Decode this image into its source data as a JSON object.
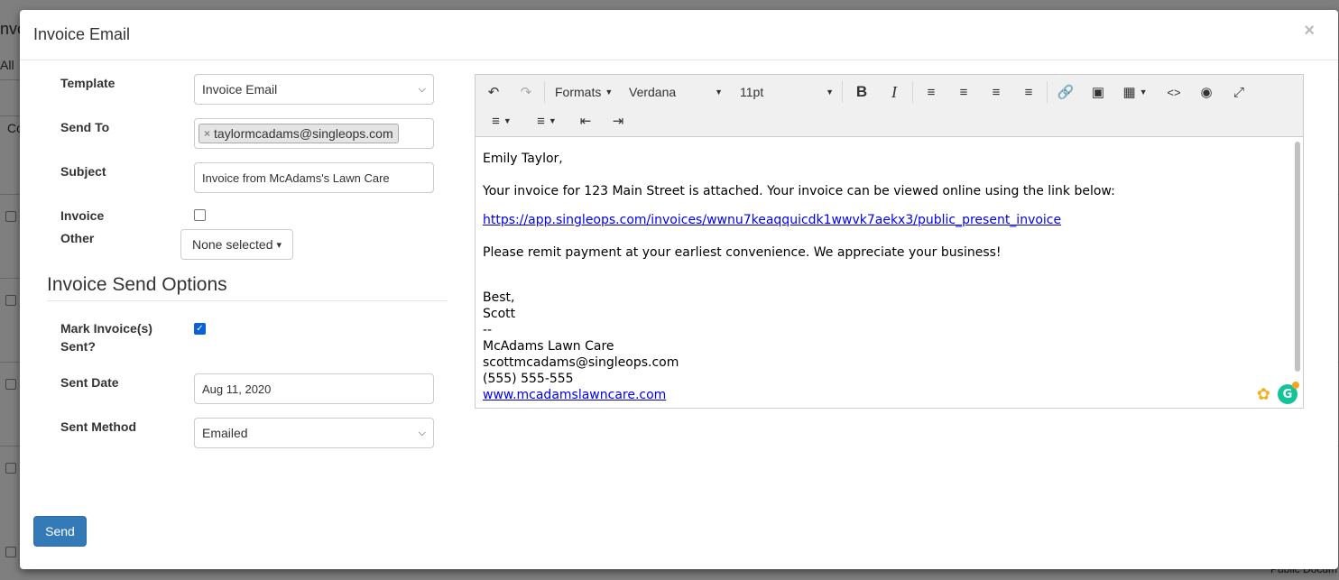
{
  "modal": {
    "title": "Invoice Email",
    "close_label": "×"
  },
  "form": {
    "template_label": "Template",
    "template_value": "Invoice Email",
    "send_to_label": "Send To",
    "send_to_tag": "taylormcadams@singleops.com",
    "tag_remove": "×",
    "subject_label": "Subject",
    "subject_value": "Invoice from McAdams's Lawn Care",
    "invoice_label": "Invoice",
    "invoice_checked": false,
    "other_label": "Other",
    "other_value": "None selected",
    "section_title": "Invoice Send Options",
    "mark_sent_label_1": "Mark Invoice(s)",
    "mark_sent_label_2": "Sent?",
    "mark_sent_checked": true,
    "sent_date_label": "Sent Date",
    "sent_date_value": "Aug 11, 2020",
    "sent_method_label": "Sent Method",
    "sent_method_value": "Emailed",
    "send_button": "Send"
  },
  "editor": {
    "toolbar": {
      "formats": "Formats",
      "font": "Verdana",
      "size": "11pt"
    },
    "body": {
      "greeting": "Emily Taylor,",
      "line1": "Your invoice for 123 Main Street is attached. Your invoice can be viewed online using the link below:",
      "link": "https://app.singleops.com/invoices/wwnu7keaqquicdk1wwvk7aekx3/public_present_invoice",
      "line2": "Please remit payment at your earliest convenience. We appreciate your business!",
      "closing": "Best,",
      "name": "Scott",
      "dashes": "--",
      "company": "McAdams Lawn Care",
      "email": "scottmcadams@singleops.com",
      "phone": "(555) 555-555",
      "website": "www.mcadamslawncare.com"
    }
  },
  "background": {
    "fragment_title": "nvo",
    "fragment_all": "All",
    "fragment_c": "Co",
    "fragment_bottom": "Public Docum"
  }
}
